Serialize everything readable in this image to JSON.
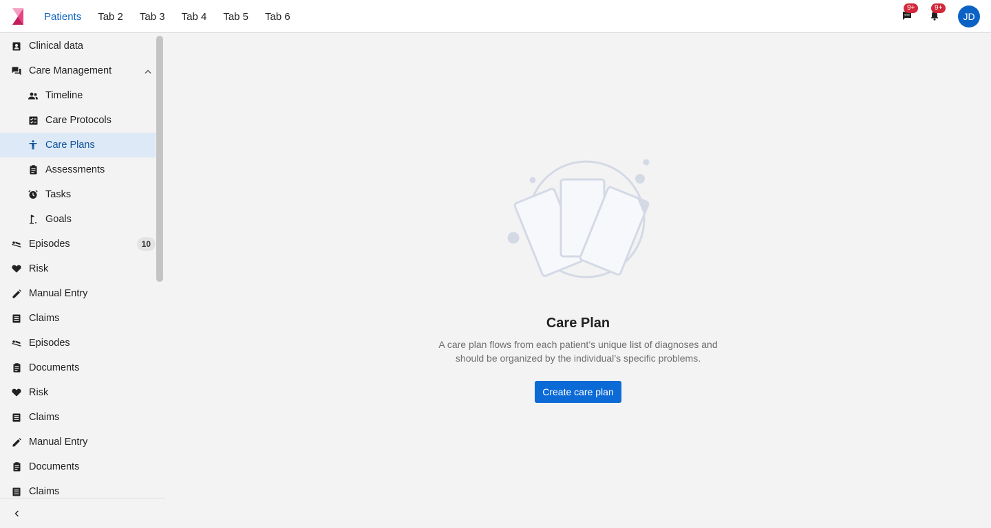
{
  "header": {
    "logo_icon": "app-logo",
    "tabs": [
      {
        "label": "Patients",
        "active": true
      },
      {
        "label": "Tab 2"
      },
      {
        "label": "Tab 3"
      },
      {
        "label": "Tab 4"
      },
      {
        "label": "Tab 5"
      },
      {
        "label": "Tab 6"
      }
    ],
    "messages": {
      "icon": "chat-icon",
      "badge": "9+"
    },
    "notifications": {
      "icon": "bell-icon",
      "badge": "9+"
    },
    "avatar_initials": "JD",
    "accent_color": "#0b62c4"
  },
  "sidebar": {
    "items": [
      {
        "label": "Clinical data",
        "icon": "contact-card-icon",
        "level": 0
      },
      {
        "label": "Care Management",
        "icon": "forum-icon",
        "level": 0,
        "expanded": true
      },
      {
        "label": "Timeline",
        "icon": "people-icon",
        "level": 1
      },
      {
        "label": "Care Protocols",
        "icon": "checklist-icon",
        "level": 1
      },
      {
        "label": "Care Plans",
        "icon": "accessibility-icon",
        "level": 1,
        "selected": true
      },
      {
        "label": "Assessments",
        "icon": "clipboard-icon",
        "level": 1
      },
      {
        "label": "Tasks",
        "icon": "alarm-icon",
        "level": 1
      },
      {
        "label": "Goals",
        "icon": "golf-icon",
        "level": 1
      },
      {
        "label": "Episodes",
        "icon": "bed-icon",
        "level": 0,
        "count": "10"
      },
      {
        "label": "Risk",
        "icon": "heart-icon",
        "level": 0
      },
      {
        "label": "Manual Entry",
        "icon": "pencil-icon",
        "level": 0
      },
      {
        "label": "Claims",
        "icon": "document-icon",
        "level": 0
      },
      {
        "label": "Episodes",
        "icon": "bed-icon",
        "level": 0
      },
      {
        "label": "Documents",
        "icon": "clipboard-icon",
        "level": 0
      },
      {
        "label": "Risk",
        "icon": "heart-icon",
        "level": 0
      },
      {
        "label": "Claims",
        "icon": "document-icon",
        "level": 0
      },
      {
        "label": "Manual Entry",
        "icon": "pencil-icon",
        "level": 0
      },
      {
        "label": "Documents",
        "icon": "clipboard-icon",
        "level": 0
      },
      {
        "label": "Claims",
        "icon": "document-icon",
        "level": 0
      }
    ],
    "collapse_icon": "chevron-left-icon"
  },
  "main": {
    "illustration": "cards-illustration",
    "title": "Care Plan",
    "description": "A care plan flows from each patient’s unique list of diagnoses and should be organized by the individual’s specific problems.",
    "cta_label": "Create care plan",
    "cta_color": "#0b6ad6"
  }
}
